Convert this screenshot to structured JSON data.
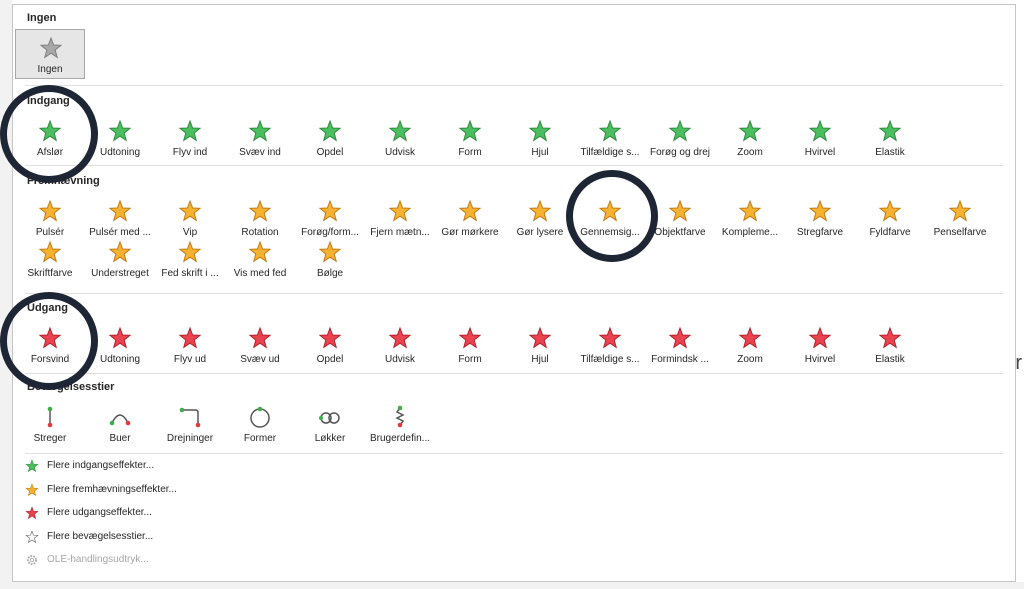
{
  "colors": {
    "entrance": "#4bbf5f",
    "emphasis": "#f5b230",
    "exit": "#e8434f",
    "path": "#555555",
    "annotation": "#1e2535"
  },
  "sections": {
    "none": {
      "title": "Ingen",
      "items": [
        {
          "label": "Ingen"
        }
      ]
    },
    "entrance": {
      "title": "Indgang",
      "items": [
        {
          "label": "Afslør"
        },
        {
          "label": "Udtoning"
        },
        {
          "label": "Flyv ind"
        },
        {
          "label": "Svæv ind"
        },
        {
          "label": "Opdel"
        },
        {
          "label": "Udvisk"
        },
        {
          "label": "Form"
        },
        {
          "label": "Hjul"
        },
        {
          "label": "Tilfældige s..."
        },
        {
          "label": "Forøg og drej"
        },
        {
          "label": "Zoom"
        },
        {
          "label": "Hvirvel"
        },
        {
          "label": "Elastik"
        }
      ]
    },
    "emphasis": {
      "title": "Fremhævning",
      "items": [
        {
          "label": "Pulsér"
        },
        {
          "label": "Pulsér med ..."
        },
        {
          "label": "Vip"
        },
        {
          "label": "Rotation"
        },
        {
          "label": "Forøg/form..."
        },
        {
          "label": "Fjern mætn..."
        },
        {
          "label": "Gør mørkere"
        },
        {
          "label": "Gør lysere"
        },
        {
          "label": "Gennemsig..."
        },
        {
          "label": "Objektfarve"
        },
        {
          "label": "Kompleme..."
        },
        {
          "label": "Stregfarve"
        },
        {
          "label": "Fyldfarve"
        },
        {
          "label": "Penselfarve"
        },
        {
          "label": "Skriftfarve"
        },
        {
          "label": "Understreget"
        },
        {
          "label": "Fed skrift i ..."
        },
        {
          "label": "Vis med fed"
        },
        {
          "label": "Bølge"
        }
      ]
    },
    "exit": {
      "title": "Udgang",
      "items": [
        {
          "label": "Forsvind"
        },
        {
          "label": "Udtoning"
        },
        {
          "label": "Flyv ud"
        },
        {
          "label": "Svæv ud"
        },
        {
          "label": "Opdel"
        },
        {
          "label": "Udvisk"
        },
        {
          "label": "Form"
        },
        {
          "label": "Hjul"
        },
        {
          "label": "Tilfældige s..."
        },
        {
          "label": "Formindsk ..."
        },
        {
          "label": "Zoom"
        },
        {
          "label": "Hvirvel"
        },
        {
          "label": "Elastik"
        }
      ]
    },
    "motion": {
      "title": "Bevægelsesstier",
      "items": [
        {
          "label": "Streger"
        },
        {
          "label": "Buer"
        },
        {
          "label": "Drejninger"
        },
        {
          "label": "Former"
        },
        {
          "label": "Løkker"
        },
        {
          "label": "Brugerdefin..."
        }
      ]
    }
  },
  "more": [
    {
      "label": "Flere indgangseffekter...",
      "icon": "green-star-icon"
    },
    {
      "label": "Flere fremhævningseffekter...",
      "icon": "yellow-star-icon"
    },
    {
      "label": "Flere udgangseffekter...",
      "icon": "red-star-icon"
    },
    {
      "label": "Flere bevægelsesstier...",
      "icon": "outline-star-icon"
    },
    {
      "label": "OLE-handlingsudtryk...",
      "icon": "gear-icon"
    }
  ]
}
